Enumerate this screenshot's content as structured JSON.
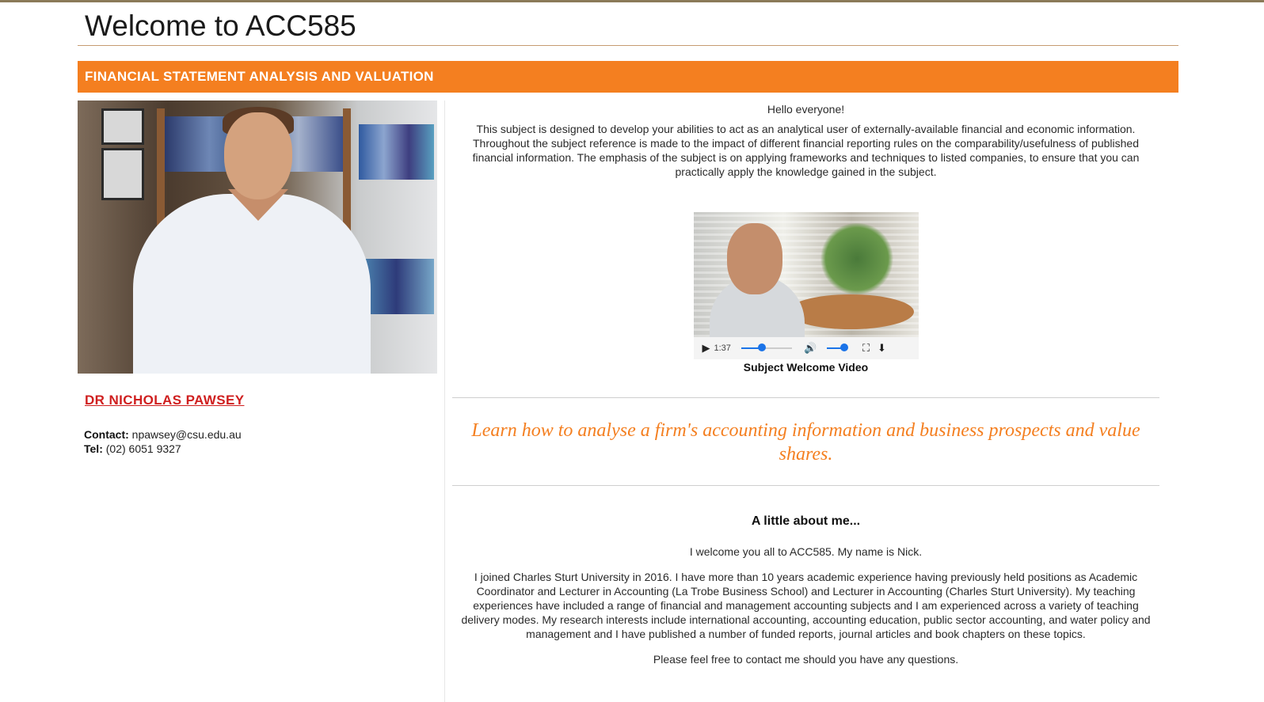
{
  "page": {
    "title": "Welcome to ACC585",
    "banner": "FINANCIAL STATEMENT ANALYSIS AND VALUATION"
  },
  "profile": {
    "name": "DR NICHOLAS PAWSEY",
    "contact_label": "Contact:",
    "contact_value": "npawsey@csu.edu.au",
    "tel_label": "Tel:",
    "tel_value": "(02) 6051 9327"
  },
  "intro": {
    "greeting": "Hello everyone!",
    "body": "This subject is designed to develop your abilities to act as an analytical user of externally-available financial and economic information. Throughout the subject reference is made to the impact of different financial reporting rules on the comparability/usefulness of published financial information. The emphasis of the subject is on applying frameworks and techniques to listed companies, to ensure that you can practically apply the knowledge gained in the subject."
  },
  "video": {
    "time": "1:37",
    "progress": 0.42,
    "volume": 0.85,
    "caption": "Subject Welcome Video",
    "icons": [
      "play-icon",
      "volume-icon",
      "fullscreen-icon",
      "download-icon"
    ]
  },
  "tagline": "Learn how to analyse a firm's accounting information and business prospects and value shares.",
  "about": {
    "heading": "A little about me...",
    "p1": "I welcome you all to ACC585. My name is Nick.",
    "p2": "I joined Charles Sturt University in 2016. I have more than 10 years academic experience having previously held positions as Academic Coordinator and Lecturer in Accounting (La Trobe Business School) and Lecturer in Accounting (Charles Sturt University). My teaching experiences have included a range of financial and management accounting subjects and I am experienced across a variety of teaching delivery modes. My research interests include international accounting, accounting education, public sector accounting, and water policy and management and I have published a number of funded reports, journal articles and book chapters on these topics.",
    "p3": "Please feel free to contact me should you have any questions."
  },
  "colors": {
    "banner": "#f47f20",
    "tagline": "#f47f20",
    "name_link": "#cf1f1f",
    "title_rule": "#c69b72"
  }
}
